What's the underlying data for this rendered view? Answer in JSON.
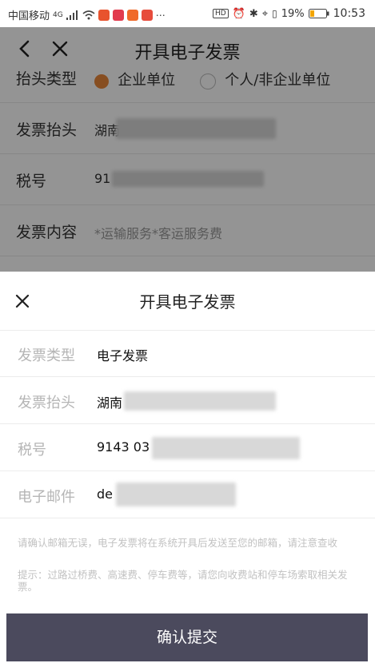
{
  "status_bar": {
    "carrier": "中国移动",
    "network": "4G",
    "battery": "19%",
    "time": "10:53",
    "hd_badge": "HD"
  },
  "nav": {
    "title": "开具电子发票",
    "back_icon": "chevron-left-icon",
    "close_icon": "close-icon"
  },
  "background_form": {
    "header_type_label": "抬头类型",
    "option_company": "企业单位",
    "option_personal": "个人/非企业单位",
    "invoice_title_label": "发票抬头",
    "invoice_title_value": "湖南",
    "tax_no_label": "税号",
    "tax_no_value": "91",
    "content_label": "发票内容",
    "content_value": "*运输服务*客运服务费"
  },
  "sheet": {
    "title": "开具电子发票",
    "rows": [
      {
        "label": "发票类型",
        "value": "电子发票"
      },
      {
        "label": "发票抬头",
        "value": "湖南"
      },
      {
        "label": "税号",
        "value": "9143 03"
      },
      {
        "label": "电子邮件",
        "value": "de"
      }
    ],
    "note1": "请确认邮箱无误，电子发票将在系统开具后发送至您的邮箱，请注意查收",
    "note2": "提示：过路过桥费、高速费、停车费等，请您向收费站和停车场索取相关发票。",
    "submit_label": "确认提交"
  },
  "colors": {
    "accent_orange": "#e8873a",
    "submit_bg": "#4b4a5d",
    "overlay": "rgba(0,0,0,0.42)"
  }
}
